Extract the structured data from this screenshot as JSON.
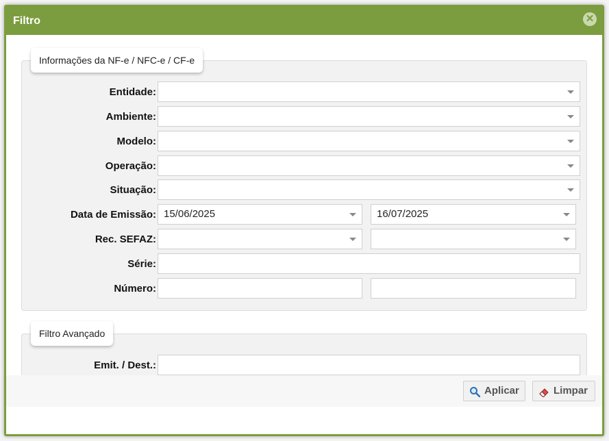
{
  "dialog": {
    "title": "Filtro",
    "close_glyph": "✕"
  },
  "section_nfe": {
    "legend": "Informações da NF-e / NFC-e / CF-e",
    "fields": {
      "entidade": {
        "label": "Entidade:",
        "value": ""
      },
      "ambiente": {
        "label": "Ambiente:",
        "value": ""
      },
      "modelo": {
        "label": "Modelo:",
        "value": ""
      },
      "operacao": {
        "label": "Operação:",
        "value": ""
      },
      "situacao": {
        "label": "Situação:",
        "value": ""
      },
      "data_emissao": {
        "label": "Data de Emissão:",
        "from": "15/06/2025",
        "to": "16/07/2025"
      },
      "rec_sefaz": {
        "label": "Rec. SEFAZ:",
        "from": "",
        "to": ""
      },
      "serie": {
        "label": "Série:",
        "value": ""
      },
      "numero": {
        "label": "Número:",
        "from": "",
        "to": ""
      }
    }
  },
  "section_advanced": {
    "legend": "Filtro Avançado",
    "fields": {
      "emit_dest": {
        "label": "Emit. / Dest.:",
        "value": ""
      }
    }
  },
  "buttons": {
    "apply": "Aplicar",
    "clear": "Limpar"
  },
  "colors": {
    "accent": "#7c9d3f"
  },
  "icons": {
    "close": "close-icon",
    "apply": "magnifier-icon",
    "clear": "eraser-icon"
  }
}
